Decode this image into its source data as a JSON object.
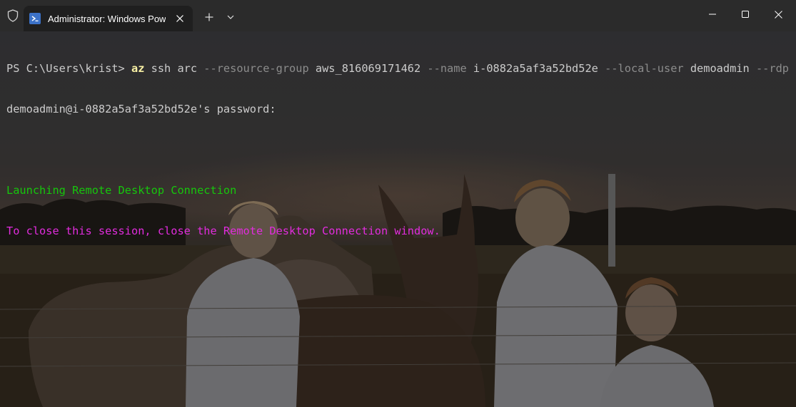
{
  "window": {
    "tab_title": "Administrator: Windows PowerShell",
    "new_tab_symbol": "+",
    "icons": {
      "shield": "shield-icon",
      "tab": "powershell-icon",
      "close_tab": "close-icon",
      "new_tab": "plus-icon",
      "dropdown": "chevron-down-icon",
      "minimize": "minimize-icon",
      "maximize": "maximize-icon",
      "close": "close-icon"
    }
  },
  "terminal": {
    "prompt": "PS C:\\Users\\krist> ",
    "command": {
      "exe": "az",
      "sub1": " ssh",
      "sub2": " arc",
      "p_rg": " --resource-group",
      "v_rg": " aws_816069171462",
      "p_name": " --name",
      "v_name": " i-0882a5af3a52bd52e",
      "p_user": " --local-user",
      "v_user": " demoadmin",
      "p_rdp": " --rdp"
    },
    "password_line": "demoadmin@i-0882a5af3a52bd52e's password:",
    "launch_line": "Launching Remote Desktop Connection",
    "close_line": "To close this session, close the Remote Desktop Connection window."
  },
  "colors": {
    "prompt_text": "#cccccc",
    "command_exe": "#f9f1a5",
    "parameter": "#8c8c8c",
    "success_green": "#16c60c",
    "notice_magenta": "#e22cde",
    "titlebar": "#2b2b2b",
    "tab_active": "#1f1f1f",
    "tab_icon": "#3c72c8"
  }
}
